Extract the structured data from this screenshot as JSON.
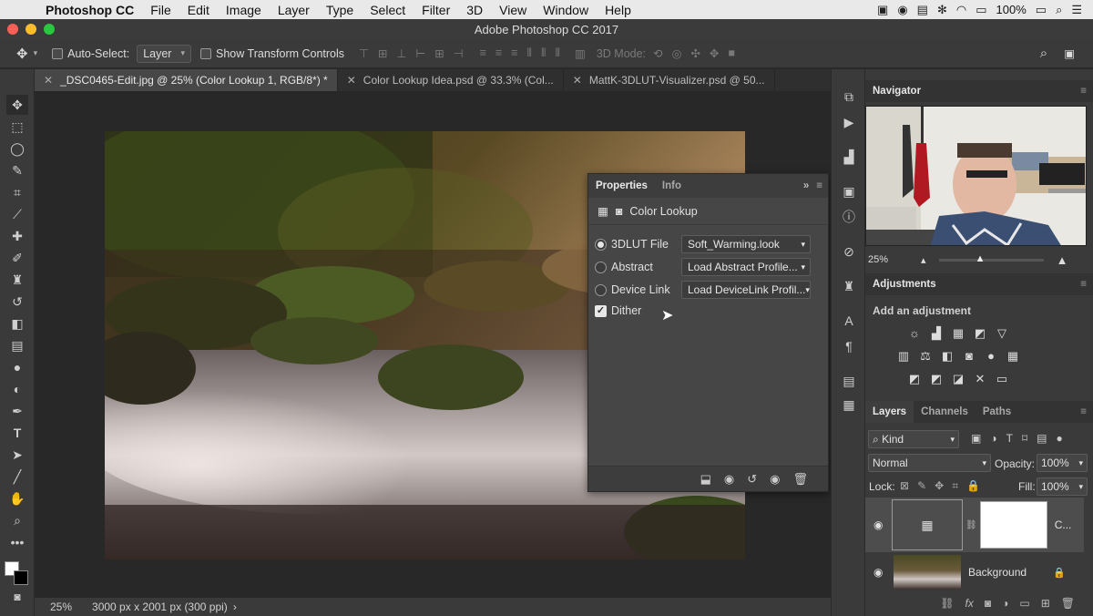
{
  "menubar": {
    "app_name": "Photoshop CC",
    "items": [
      "File",
      "Edit",
      "Image",
      "Layer",
      "Type",
      "Select",
      "Filter",
      "3D",
      "View",
      "Window",
      "Help"
    ],
    "battery": "100%"
  },
  "window": {
    "title": "Adobe Photoshop CC 2017"
  },
  "options_bar": {
    "auto_select_label": "Auto-Select:",
    "auto_select_value": "Layer",
    "show_transform_label": "Show Transform Controls",
    "mode_3d_label": "3D Mode:"
  },
  "tabs": [
    {
      "label": "_DSC0465-Edit.jpg @ 25% (Color Lookup 1, RGB/8*) *"
    },
    {
      "label": "Color Lookup Idea.psd @ 33.3% (Col..."
    },
    {
      "label": "MattK-3DLUT-Visualizer.psd @ 50..."
    }
  ],
  "status": {
    "zoom": "25%",
    "doc_info": "3000 px x 2001 px (300 ppi)"
  },
  "properties": {
    "tab_properties": "Properties",
    "tab_info": "Info",
    "section_title": "Color Lookup",
    "lut_label": "3DLUT File",
    "lut_value": "Soft_Warming.look",
    "abstract_label": "Abstract",
    "abstract_value": "Load Abstract Profile...",
    "device_label": "Device Link",
    "device_value": "Load DeviceLink Profil...",
    "dither_label": "Dither"
  },
  "navigator": {
    "title": "Navigator",
    "zoom": "25%"
  },
  "adjustments": {
    "title": "Adjustments",
    "subtitle": "Add an adjustment"
  },
  "layers": {
    "tab_layers": "Layers",
    "tab_channels": "Channels",
    "tab_paths": "Paths",
    "kind_label": "Kind",
    "blend_mode": "Normal",
    "opacity_label": "Opacity:",
    "opacity_value": "100%",
    "lock_label": "Lock:",
    "fill_label": "Fill:",
    "fill_value": "100%",
    "layer1_name": "C...",
    "layer2_name": "Background"
  },
  "colors": {
    "accent": "#2d8ceb",
    "panel": "#3a3a3a",
    "canvas": "#282828"
  }
}
